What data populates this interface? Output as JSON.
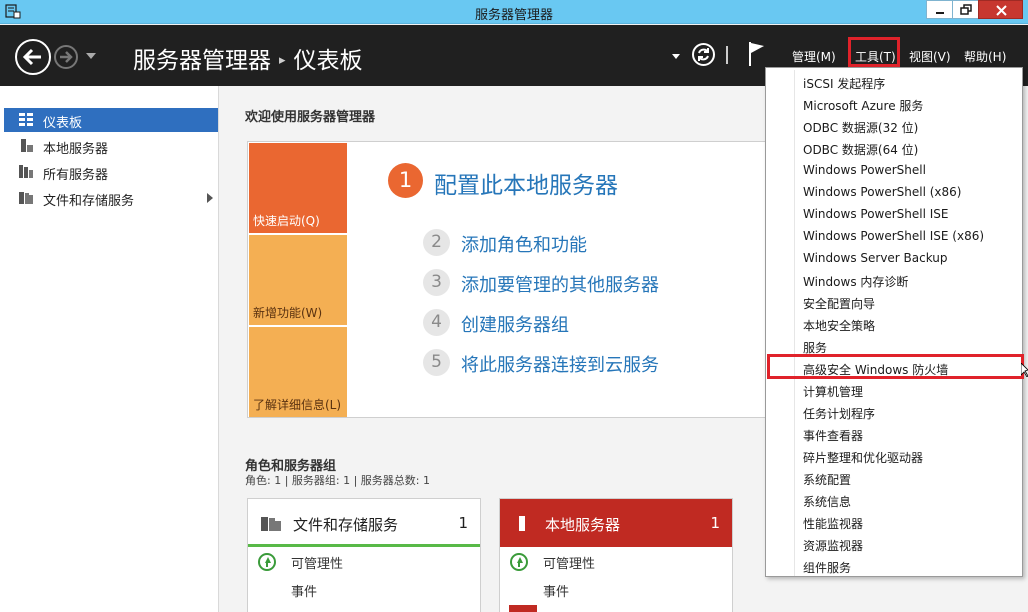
{
  "window": {
    "title": "服务器管理器"
  },
  "header": {
    "breadcrumb_root": "服务器管理器",
    "breadcrumb_separator": "▸",
    "breadcrumb_current": "仪表板",
    "menus": {
      "manage": "管理(M)",
      "tools": "工具(T)",
      "view": "视图(V)",
      "help": "帮助(H)"
    }
  },
  "sidebar": {
    "items": [
      {
        "label": "仪表板",
        "icon": "dashboard-icon",
        "active": true
      },
      {
        "label": "本地服务器",
        "icon": "server-icon",
        "active": false
      },
      {
        "label": "所有服务器",
        "icon": "servers-icon",
        "active": false
      },
      {
        "label": "文件和存储服务",
        "icon": "storage-icon",
        "active": false
      }
    ]
  },
  "welcome": {
    "heading": "欢迎使用服务器管理器",
    "tiles": {
      "quick_start": "快速启动(Q)",
      "whats_new": "新增功能(W)",
      "learn_more": "了解详细信息(L)"
    },
    "step1": {
      "number": "1",
      "text": "配置此本地服务器"
    },
    "steps": [
      {
        "number": "2",
        "text": "添加角色和功能"
      },
      {
        "number": "3",
        "text": "添加要管理的其他服务器"
      },
      {
        "number": "4",
        "text": "创建服务器组"
      },
      {
        "number": "5",
        "text": "将此服务器连接到云服务"
      }
    ]
  },
  "roles": {
    "heading": "角色和服务器组",
    "summary": "角色: 1 | 服务器组: 1 | 服务器总数: 1",
    "cards": [
      {
        "title": "文件和存储服务",
        "count": "1",
        "rows": [
          "可管理性",
          "事件"
        ]
      },
      {
        "title": "本地服务器",
        "count": "1",
        "rows": [
          "可管理性",
          "事件"
        ]
      }
    ]
  },
  "tools_menu": {
    "items": [
      "iSCSI 发起程序",
      "Microsoft Azure 服务",
      "ODBC 数据源(32 位)",
      "ODBC 数据源(64 位)",
      "Windows PowerShell",
      "Windows PowerShell (x86)",
      "Windows PowerShell ISE",
      "Windows PowerShell ISE (x86)",
      "Windows Server Backup",
      "Windows 内存诊断",
      "安全配置向导",
      "本地安全策略",
      "服务",
      "高级安全 Windows 防火墙",
      "计算机管理",
      "任务计划程序",
      "事件查看器",
      "碎片整理和优化驱动器",
      "系统配置",
      "系统信息",
      "性能监视器",
      "资源监视器",
      "组件服务"
    ],
    "highlighted_item": "高级安全 Windows 防火墙"
  },
  "colors": {
    "titlebar": "#69c8f2",
    "header": "#202020",
    "sidebar_active": "#2f6fbf",
    "quick_start_tile": "#ea6731",
    "tile_secondary": "#f4af53",
    "link_blue": "#2676b9",
    "local_server_red": "#c02a22",
    "highlight_red": "#e0222a",
    "healthy_green": "#58b947"
  }
}
